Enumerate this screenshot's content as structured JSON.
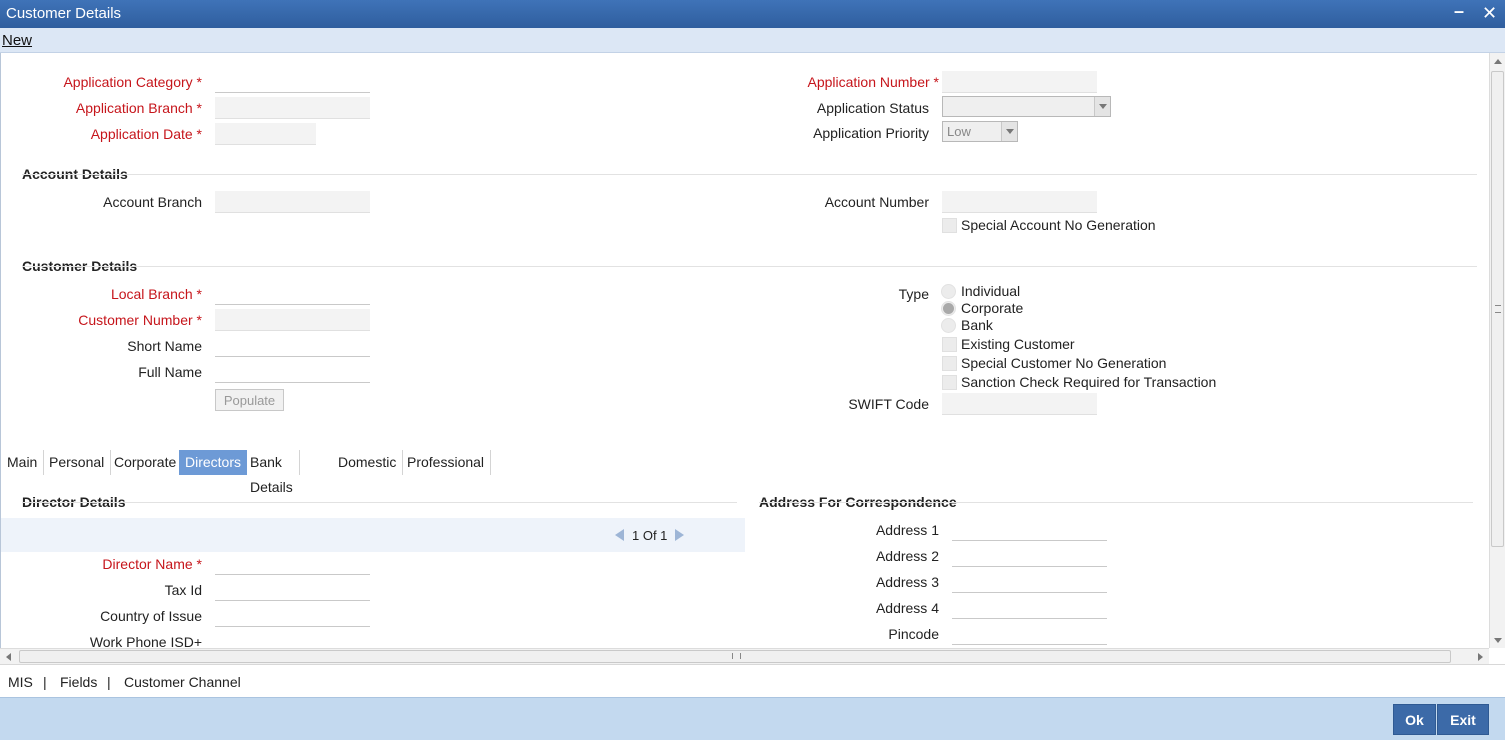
{
  "window": {
    "title": "Customer Details"
  },
  "menu": {
    "new_label": "New"
  },
  "application": {
    "category_label": "Application Category",
    "branch_label": "Application Branch",
    "date_label": "Application Date",
    "number_label": "Application Number",
    "status_label": "Application Status",
    "status_value": "",
    "priority_label": "Application Priority",
    "priority_value": "Low"
  },
  "account": {
    "section_title": "Account Details",
    "branch_label": "Account Branch",
    "number_label": "Account Number",
    "special_no_label": "Special Account No Generation"
  },
  "customer": {
    "section_title": "Customer Details",
    "local_branch_label": "Local Branch",
    "customer_number_label": "Customer Number",
    "short_name_label": "Short Name",
    "full_name_label": "Full Name",
    "populate_label": "Populate",
    "type_label": "Type",
    "type_options": [
      "Individual",
      "Corporate",
      "Bank"
    ],
    "type_selected": "Corporate",
    "existing_customer_label": "Existing Customer",
    "special_customer_no_label": "Special Customer No Generation",
    "sanction_check_label": "Sanction Check Required for Transaction",
    "swift_code_label": "SWIFT Code"
  },
  "tabs": [
    {
      "label": "Main"
    },
    {
      "label": "Personal"
    },
    {
      "label": "Corporate"
    },
    {
      "label": "Directors",
      "active": true
    },
    {
      "label": "Bank Details"
    },
    {
      "label": "Domestic"
    },
    {
      "label": "Professional"
    }
  ],
  "directors": {
    "section_title": "Director Details",
    "pager_text": "1 Of 1",
    "director_name_label": "Director Name",
    "tax_id_label": "Tax Id",
    "country_of_issue_label": "Country of Issue",
    "work_phone_label": "Work Phone ISD+"
  },
  "address": {
    "section_title": "Address For Correspondence",
    "address1_label": "Address 1",
    "address2_label": "Address 2",
    "address3_label": "Address 3",
    "address4_label": "Address 4",
    "pincode_label": "Pincode"
  },
  "links": {
    "mis": "MIS",
    "fields": "Fields",
    "customer_channel": "Customer Channel",
    "separator": "|"
  },
  "footer": {
    "ok_label": "Ok",
    "exit_label": "Exit"
  },
  "colors": {
    "titlebar": "#3f73b8",
    "required_label": "#c6151b",
    "active_tab": "#6d9ad6",
    "footer": "#c3d9ef",
    "button": "#3c6aa8"
  }
}
